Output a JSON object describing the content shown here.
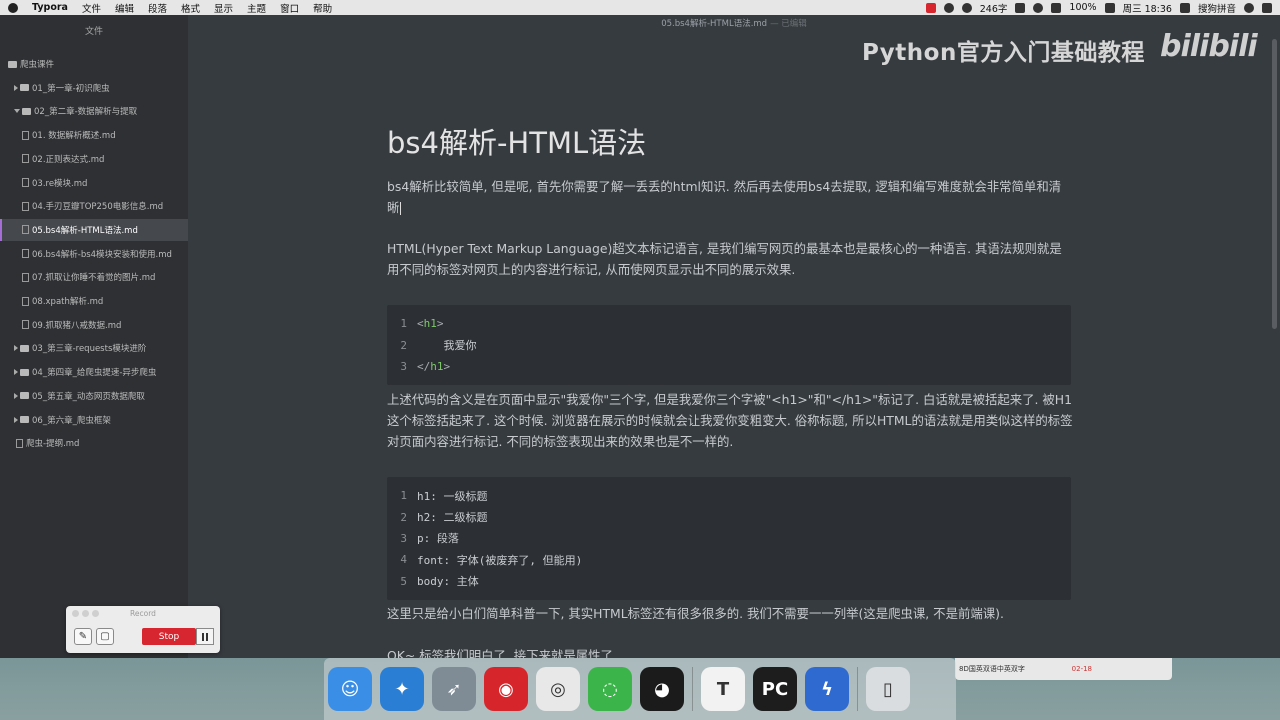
{
  "menubar": {
    "app_name": "Typora",
    "menus": [
      "文件",
      "编辑",
      "段落",
      "格式",
      "显示",
      "主题",
      "窗口",
      "帮助"
    ],
    "tray": {
      "word_count": "246字",
      "battery": "100%",
      "clock": "周三 18:36",
      "input_method": "搜狗拼音"
    }
  },
  "window": {
    "title": "05.bs4解析-HTML语法.md",
    "edited_suffix": "— 已编辑"
  },
  "sidebar": {
    "header": "文件",
    "items": [
      {
        "label": "爬虫课件",
        "kind": "folder"
      },
      {
        "label": "01_第一章-初识爬虫",
        "kind": "folder"
      },
      {
        "label": "02_第二章-数据解析与提取",
        "kind": "folder"
      },
      {
        "label": "01. 数据解析概述.md",
        "kind": "file"
      },
      {
        "label": "02.正则表达式.md",
        "kind": "file"
      },
      {
        "label": "03.re模块.md",
        "kind": "file"
      },
      {
        "label": "04.手刃豆瓣TOP250电影信息.md",
        "kind": "file"
      },
      {
        "label": "05.bs4解析-HTML语法.md",
        "kind": "file"
      },
      {
        "label": "06.bs4解析-bs4模块安装和使用.md",
        "kind": "file"
      },
      {
        "label": "07.抓取让你睡不着觉的图片.md",
        "kind": "file"
      },
      {
        "label": "08.xpath解析.md",
        "kind": "file"
      },
      {
        "label": "09.抓取猪八戒数据.md",
        "kind": "file"
      },
      {
        "label": "03_第三章-requests模块进阶",
        "kind": "folder"
      },
      {
        "label": "04_第四章_给爬虫提速-异步爬虫",
        "kind": "folder"
      },
      {
        "label": "05_第五章_动态网页数据爬取",
        "kind": "folder"
      },
      {
        "label": "06_第六章_爬虫框架",
        "kind": "folder"
      },
      {
        "label": "爬虫-提纲.md",
        "kind": "file"
      }
    ]
  },
  "watermark": {
    "text": "Python官方入门基础教程",
    "logo": "bilibili"
  },
  "document": {
    "title": "bs4解析-HTML语法",
    "p1": "bs4解析比较简单, 但是呢, 首先你需要了解一丢丢的html知识. 然后再去使用bs4去提取, 逻辑和编写难度就会非常简单和清晰",
    "p2": "HTML(Hyper Text Markup Language)超文本标记语言, 是我们编写网页的最基本也是最核心的一种语言. 其语法规则就是用不同的标签对网页上的内容进行标记, 从而使网页显示出不同的展示效果.",
    "code1": [
      {
        "ln": "1",
        "open": "<",
        "tag": "h1",
        "close": ">",
        "text": ""
      },
      {
        "ln": "2",
        "open": "",
        "tag": "",
        "close": "",
        "text": "    我爱你"
      },
      {
        "ln": "3",
        "open": "</",
        "tag": "h1",
        "close": ">",
        "text": ""
      }
    ],
    "p3": "上述代码的含义是在页面中显示\"我爱你\"三个字, 但是我爱你三个字被\"<h1>\"和\"</h1>\"标记了. 白话就是被括起来了. 被H1这个标签括起来了. 这个时候. 浏览器在展示的时候就会让我爱你变粗变大. 俗称标题, 所以HTML的语法就是用类似这样的标签对页面内容进行标记. 不同的标签表现出来的效果也是不一样的.",
    "code2": [
      {
        "ln": "1",
        "text": "h1: 一级标题"
      },
      {
        "ln": "2",
        "text": "h2: 二级标题"
      },
      {
        "ln": "3",
        "text": "p: 段落"
      },
      {
        "ln": "4",
        "text": "font: 字体(被废弃了, 但能用)"
      },
      {
        "ln": "5",
        "text": "body: 主体"
      }
    ],
    "p4": "这里只是给小白们简单科普一下, 其实HTML标签还有很多很多的. 我们不需要一一列举(这是爬虫课, 不是前端课).",
    "p5": "OK~ 标签我们明白了, 接下来就是属性了"
  },
  "record_widget": {
    "title": "Record",
    "stop_label": "Stop"
  },
  "notification": {
    "text": "8D国英双语中英双字",
    "date": "02-18"
  },
  "dock": {
    "apps": [
      {
        "name": "finder-icon",
        "glyph": "☺",
        "color": "#3a8ee6"
      },
      {
        "name": "safari-icon",
        "glyph": "✦",
        "color": "#2a7fd4"
      },
      {
        "name": "launchpad-icon",
        "glyph": "➶",
        "color": "#7f8c96"
      },
      {
        "name": "netease-music-icon",
        "glyph": "◉",
        "color": "#d6262b"
      },
      {
        "name": "chrome-icon",
        "glyph": "◎",
        "color": "#e8e8e8"
      },
      {
        "name": "wechat-icon",
        "glyph": "◌",
        "color": "#3bb54a"
      },
      {
        "name": "qq-icon",
        "glyph": "◕",
        "color": "#1b1b1b"
      },
      {
        "name": "typora-icon",
        "glyph": "T",
        "color": "#f2f2f2"
      },
      {
        "name": "pycharm-icon",
        "glyph": "PC",
        "color": "#1d1d1d"
      },
      {
        "name": "thunder-icon",
        "glyph": "ϟ",
        "color": "#2f6ad0"
      },
      {
        "name": "trash-icon",
        "glyph": "▯",
        "color": "#d9dde0"
      }
    ]
  }
}
